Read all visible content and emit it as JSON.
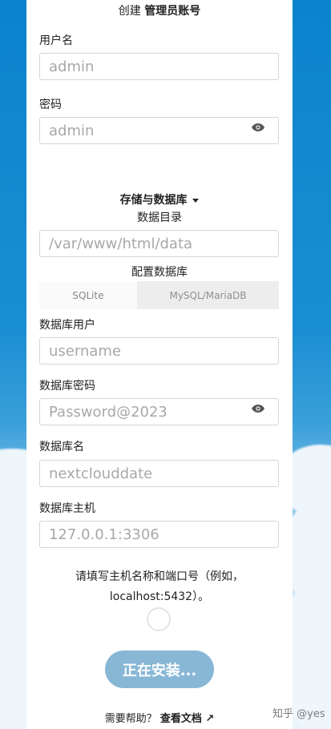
{
  "header": {
    "title_prefix": "创建",
    "title_bold": "管理员账号"
  },
  "admin": {
    "username_label": "用户名",
    "username_placeholder": "admin",
    "password_label": "密码",
    "password_placeholder": "admin"
  },
  "storage": {
    "section_label": "存储与数据库",
    "data_dir_label": "数据目录",
    "data_dir_placeholder": "/var/www/html/data",
    "db_config_label": "配置数据库",
    "tabs": [
      {
        "label": "SQLite"
      },
      {
        "label": "MySQL/MariaDB"
      }
    ],
    "db_user_label": "数据库用户",
    "db_user_placeholder": "username",
    "db_password_label": "数据库密码",
    "db_password_placeholder": "Password@2023",
    "db_name_label": "数据库名",
    "db_name_placeholder": "nextclouddate",
    "db_host_label": "数据库主机",
    "db_host_placeholder": "127.0.0.1:3306",
    "db_host_hint_line1": "请填写主机名称和端口号（例如，",
    "db_host_hint_line2": "localhost:5432）。"
  },
  "install": {
    "button_label": "正在安装..."
  },
  "footer": {
    "help_text": "需要帮助？",
    "docs_link": "查看文档 ↗"
  },
  "watermark": "知乎 @yes",
  "icons": {
    "eye": "eye-icon",
    "caret": "caret-down-icon",
    "spinner": "loading-spinner"
  },
  "colors": {
    "background_blue": "#0082c9",
    "button_disabled": "#88b7d6"
  }
}
